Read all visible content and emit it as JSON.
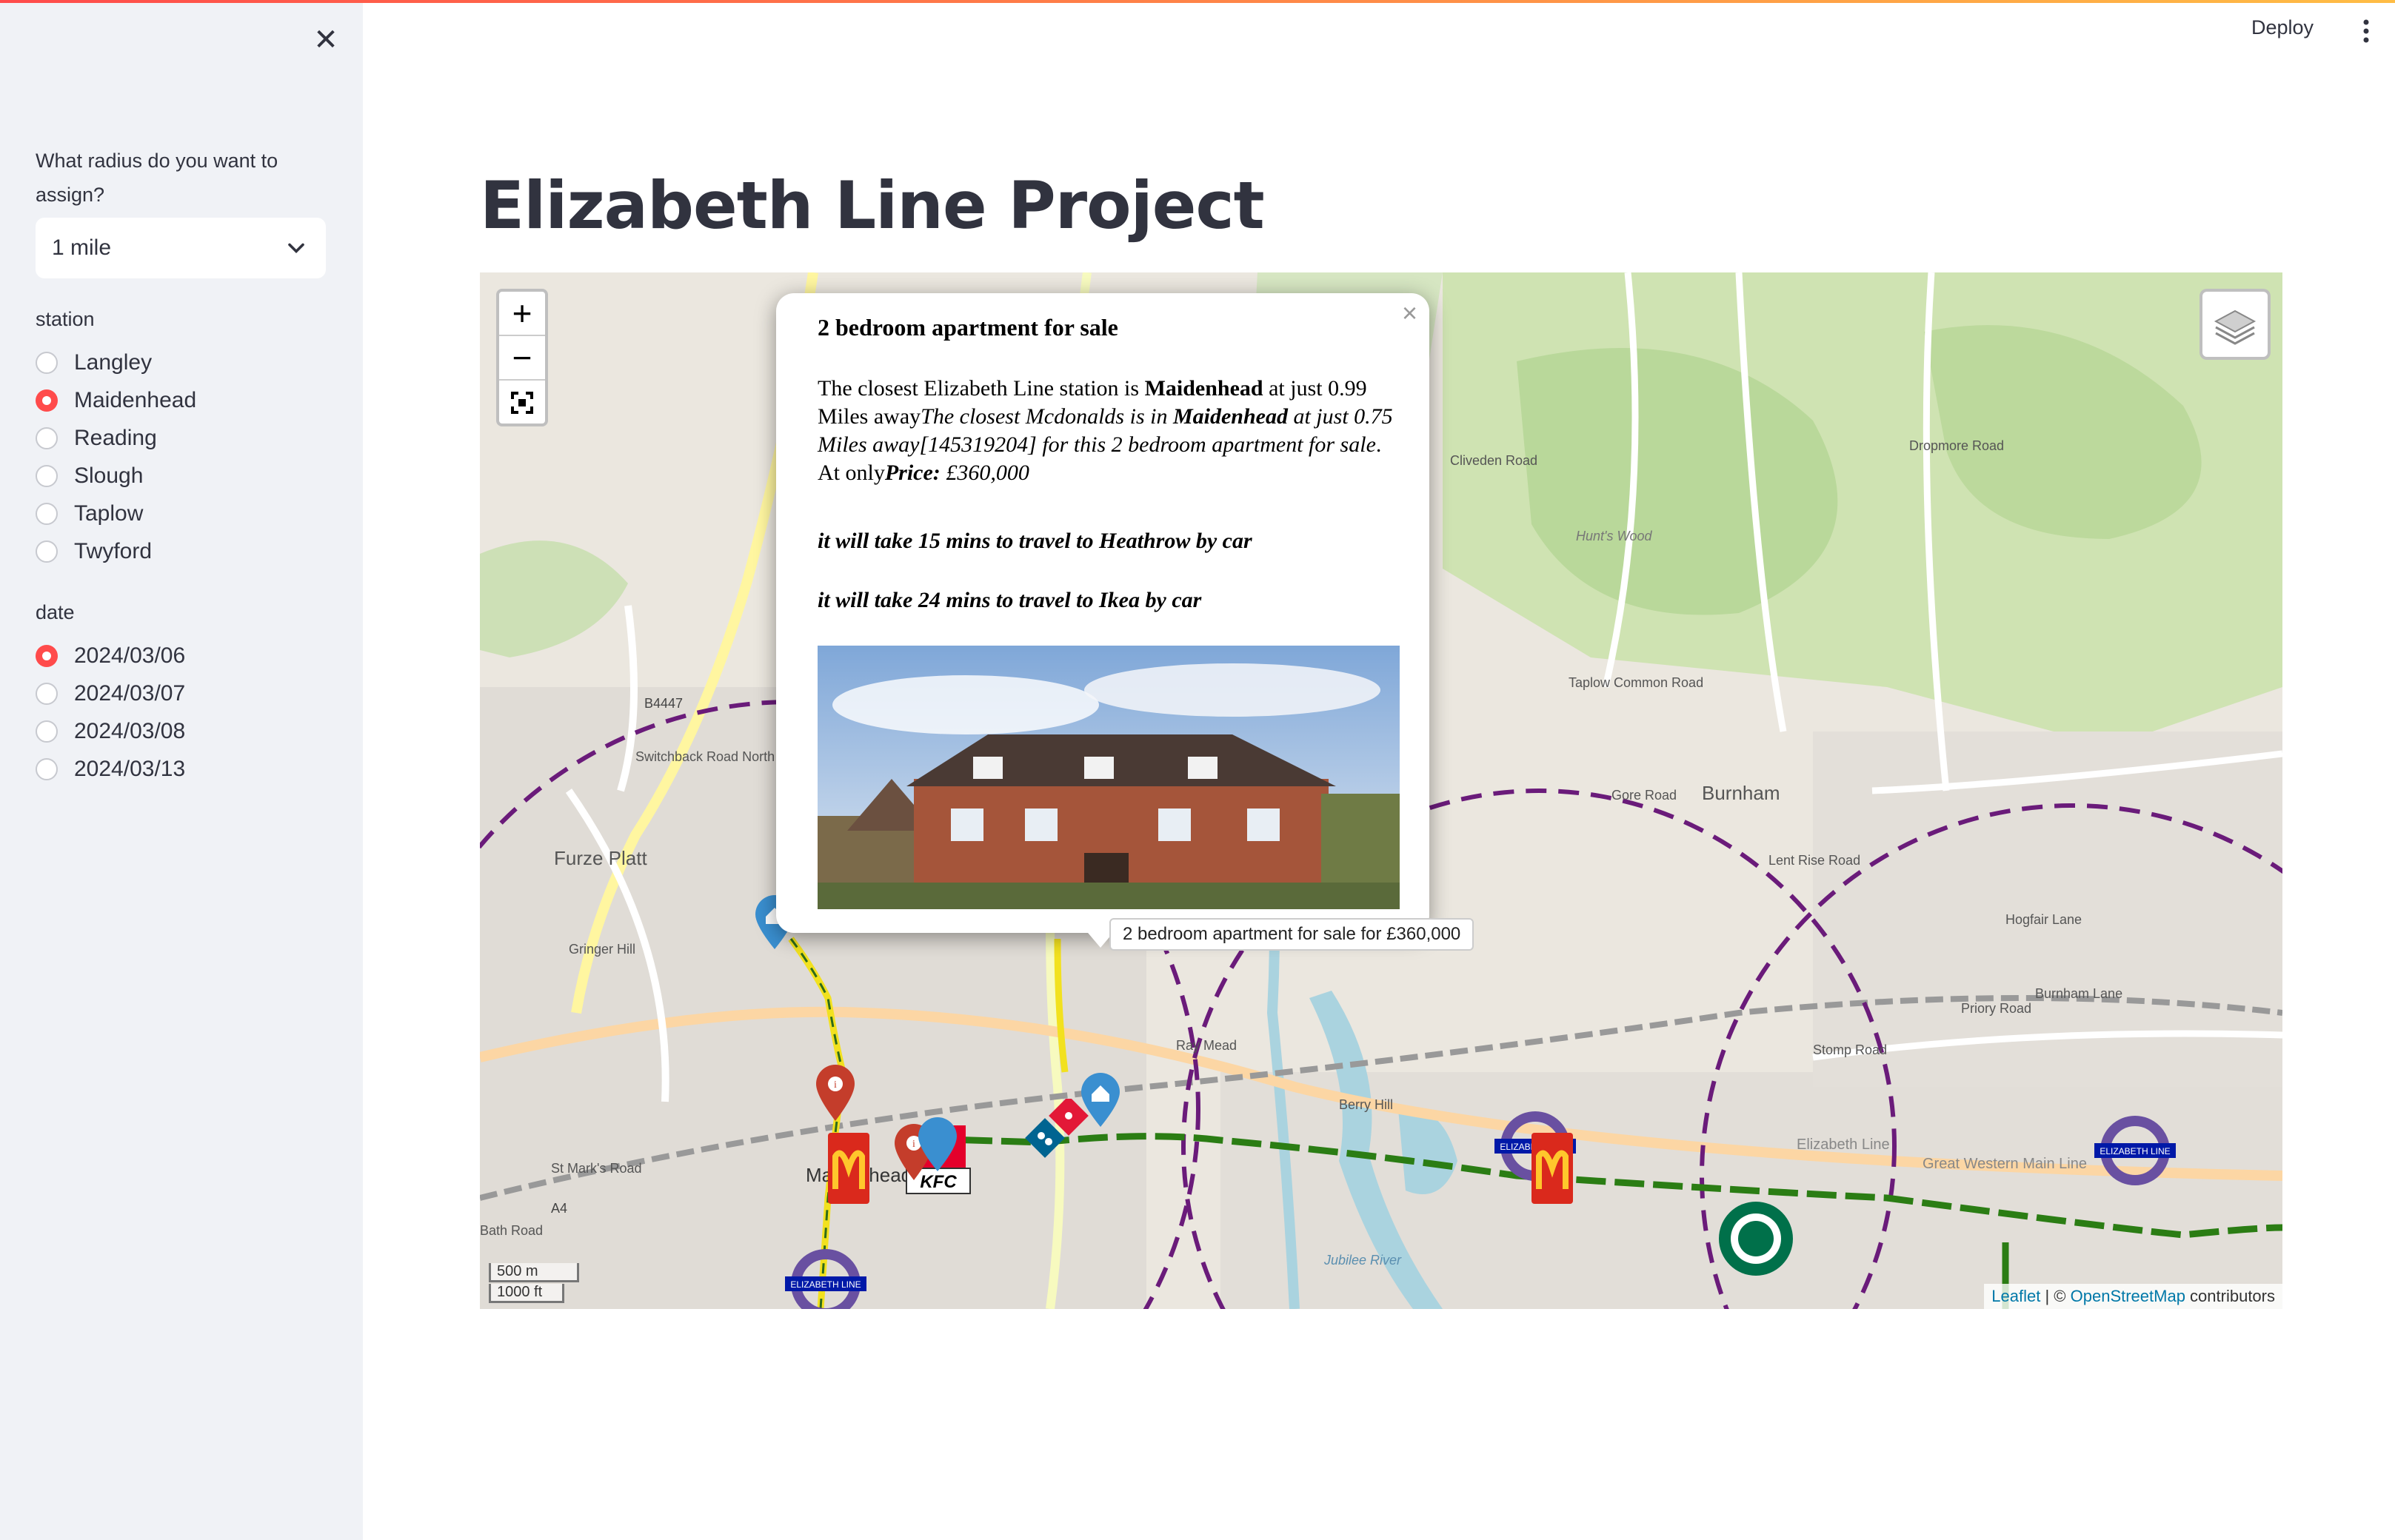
{
  "header": {
    "deploy_label": "Deploy"
  },
  "sidebar": {
    "radius_label": "What radius do you want to assign?",
    "radius_value": "1 mile",
    "station_label": "station",
    "stations": [
      {
        "label": "Langley",
        "selected": false
      },
      {
        "label": "Maidenhead",
        "selected": true
      },
      {
        "label": "Reading",
        "selected": false
      },
      {
        "label": "Slough",
        "selected": false
      },
      {
        "label": "Taplow",
        "selected": false
      },
      {
        "label": "Twyford",
        "selected": false
      }
    ],
    "date_label": "date",
    "dates": [
      {
        "label": "2024/03/06",
        "selected": true
      },
      {
        "label": "2024/03/07",
        "selected": false
      },
      {
        "label": "2024/03/08",
        "selected": false
      },
      {
        "label": "2024/03/13",
        "selected": false
      }
    ]
  },
  "main": {
    "title": "Elizabeth Line Project"
  },
  "map": {
    "zoom_in": "+",
    "zoom_out": "−",
    "popup": {
      "close": "×",
      "heading": "2 bedroom apartment for sale",
      "text_1": "The closest Elizabeth Line station is ",
      "station": "Maidenhead",
      "text_2": " at just 0.99 Miles away",
      "text_3": "The closest Mcdonalds is in ",
      "mcd_location": "Maidenhead",
      "text_4": " at just 0.75 Miles away[145319204] for this 2 bedroom apartment for sale",
      "text_5": ". At only",
      "price_label": "Price: ",
      "price": "£360,000",
      "travel_heathrow": "it will take 15 mins to travel to Heathrow by car",
      "travel_ikea": "it will take 24 mins to travel to Ikea by car"
    },
    "tooltip": "2 bedroom apartment for sale for £360,000",
    "scale_m": "500 m",
    "scale_ft": "1000 ft",
    "attribution_leaflet": "Leaflet",
    "attribution_sep": " | © ",
    "attribution_osm": "OpenStreetMap",
    "attribution_tail": " contributors",
    "place_labels": {
      "furze_platt": "Furze Platt",
      "burnham": "Burnham",
      "b4447": "B4447",
      "a4": "A4",
      "gore_road": "Gore Road",
      "stomp_road": "Stomp Road",
      "priory_road": "Priory Road",
      "burnham_lane": "Burnham Lane",
      "elizabeth_line": "Elizabeth Line",
      "great_western": "Great Western Main Line",
      "st_marks": "St Mark's Road",
      "bath_road": "Bath Road",
      "switchback": "Switchback Road North",
      "cliveden": "Cliveden Road",
      "taplow_common": "Taplow Common Road",
      "dropmore": "Dropmore Road",
      "huntswood": "Hunt's Wood",
      "ray_mead": "Ray Mead",
      "berry_hill": "Berry Hill",
      "lent_rise": "Lent Rise Road",
      "hogfair": "Hogfair Lane",
      "jubilee": "Jubilee River",
      "gringer_hill": "Gringer Hill",
      "station_badge": "ELIZABETH LINE",
      "kfc": "KFC",
      "maidenhead_map": "Maidenhead"
    }
  }
}
